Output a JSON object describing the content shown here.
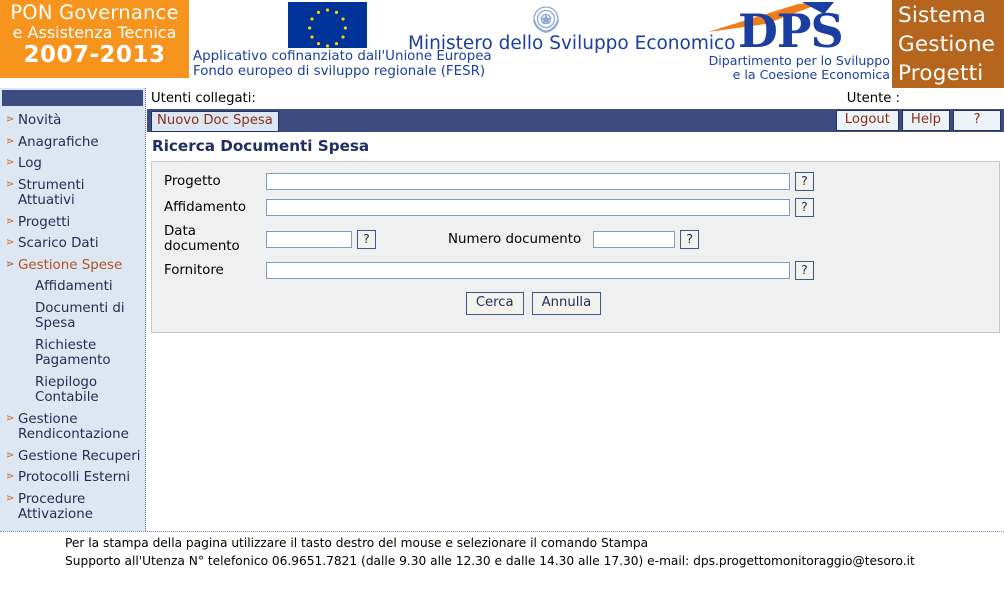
{
  "header": {
    "pon_logo": {
      "line1": "PON Governance",
      "line2": "e Assistenza Tecnica",
      "line3": "2007-2013"
    },
    "fesr": {
      "line1": "Applicativo cofinanziato dall'Unione Europea",
      "line2": "Fondo europeo di sviluppo regionale (FESR)"
    },
    "ministry": "Ministero dello Sviluppo Economico",
    "dps": {
      "acronym": "DPS",
      "sub_line1": "Dipartimento per lo Sviluppo",
      "sub_line2": "e la Coesione Economica"
    },
    "sgp_logo": {
      "line1": "Sistema",
      "line2": "Gestione",
      "line3": "Progetti"
    },
    "colors": {
      "pon_orange": "#f7941e",
      "sgp_brown": "#b5651d",
      "eu_blue": "#003399",
      "nav_navy": "#3c4b80",
      "sidebar_blue": "#dde6f3",
      "accent_orange": "#b5521e"
    }
  },
  "sidebar": {
    "items": [
      {
        "label": "Novità",
        "sub": false,
        "active": false
      },
      {
        "label": "Anagrafiche",
        "sub": false,
        "active": false
      },
      {
        "label": "Log",
        "sub": false,
        "active": false
      },
      {
        "label": "Strumenti Attuativi",
        "sub": false,
        "active": false
      },
      {
        "label": "Progetti",
        "sub": false,
        "active": false
      },
      {
        "label": "Scarico Dati",
        "sub": false,
        "active": false
      },
      {
        "label": "Gestione Spese",
        "sub": false,
        "active": true
      },
      {
        "label": "Affidamenti",
        "sub": true,
        "active": false
      },
      {
        "label": "Documenti di Spesa",
        "sub": true,
        "active": false
      },
      {
        "label": "Richieste Pagamento",
        "sub": true,
        "active": false
      },
      {
        "label": "Riepilogo Contabile",
        "sub": true,
        "active": false
      },
      {
        "label": "Gestione Rendicontazione",
        "sub": false,
        "active": false
      },
      {
        "label": "Gestione Recuperi",
        "sub": false,
        "active": false
      },
      {
        "label": "Protocolli Esterni",
        "sub": false,
        "active": false
      },
      {
        "label": "Procedure Attivazione",
        "sub": false,
        "active": false
      }
    ]
  },
  "userbar": {
    "connected_users_label": "Utenti collegati:",
    "user_label": "Utente :"
  },
  "navbar": {
    "tab_label": "Nuovo Doc Spesa",
    "logout_label": "Logout",
    "help_label": "Help",
    "question_label": "?"
  },
  "main": {
    "page_title": "Ricerca Documenti Spesa",
    "fields": {
      "progetto": {
        "label": "Progetto",
        "value": "",
        "placeholder": "",
        "help": "?"
      },
      "affidamento": {
        "label": "Affidamento",
        "value": "",
        "placeholder": "",
        "help": "?"
      },
      "data_documento": {
        "label": "Data documento",
        "value": "",
        "placeholder": "",
        "help": "?"
      },
      "numero_documento": {
        "label": "Numero documento",
        "value": "",
        "placeholder": "",
        "help": "?"
      },
      "fornitore": {
        "label": "Fornitore",
        "value": "",
        "placeholder": "",
        "help": "?"
      }
    },
    "buttons": {
      "search": "Cerca",
      "cancel": "Annulla"
    }
  },
  "footer": {
    "line1": "Per la stampa della pagina utilizzare il tasto destro del mouse e selezionare il comando Stampa",
    "line2": "Supporto all'Utenza N° telefonico 06.9651.7821 (dalle 9.30 alle 12.30 e dalle 14.30 alle 17.30) e-mail: dps.progettomonitoraggio@tesoro.it"
  }
}
